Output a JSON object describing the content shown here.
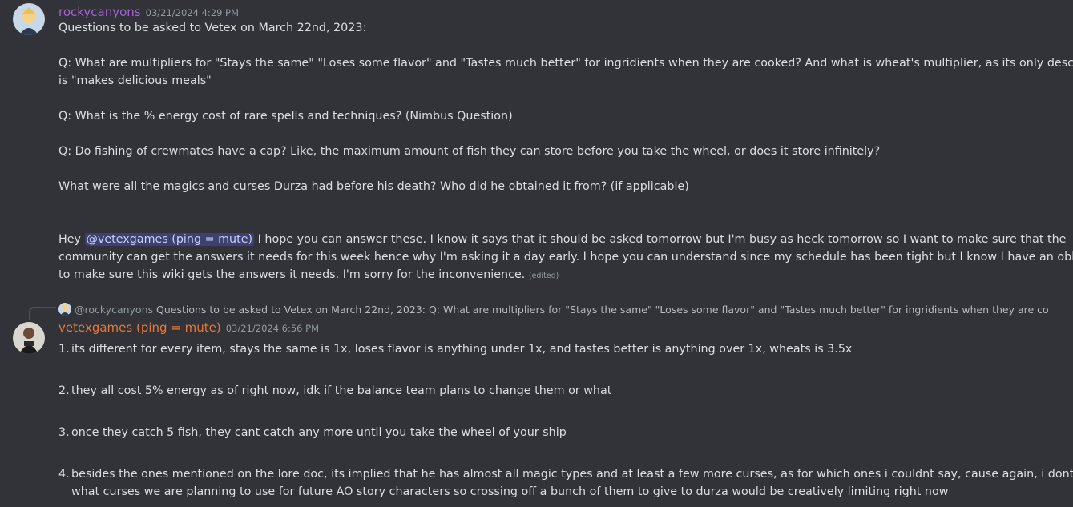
{
  "message1": {
    "username": "rockycanyons",
    "username_color": "#a95fd6",
    "timestamp": "03/21/2024 4:29 PM",
    "title_line": "Questions to be asked to Vetex on March 22nd, 2023:",
    "q1_line1": "Q: What are multipliers for \"Stays the same\" \"Loses some flavor\" and \"Tastes much better\" for ingridients when they are cooked? And what is wheat's multiplier, as its only description",
    "q1_line2": "is \"makes delicious meals\"",
    "q2": "Q: What is the % energy cost of rare spells and techniques? (Nimbus Question)",
    "q3": "Q: Do fishing of crewmates have a cap? Like, the maximum amount of fish they can store before you take the wheel, or does it store infinitely?",
    "q4": "What were all the magics and curses Durza had before his death? Who did he obtained it from? (if applicable)",
    "closing_prefix": "Hey ",
    "mention": "@vetexgames (ping = mute)",
    "closing_line1_rest": " I hope you can answer these. I know it says that it should be asked tomorrow but I'm busy as heck tomorrow so I want to make sure that the",
    "closing_line2": "community can get the answers it needs for this week hence why I'm asking it a day early. I hope you can understand since my schedule has been tight but I know I have an obligation",
    "closing_line3": "to make sure this wiki gets the answers it needs. I'm sorry for the inconvenience.",
    "edited_label": "(edited)"
  },
  "reply_reference": {
    "username": "@rockycanyons",
    "preview": "Questions to be asked to Vetex on March 22nd, 2023: Q: What are multipliers for \"Stays the same\" \"Loses some flavor\" and \"Tastes much better\" for ingridients when they are cooked? And w"
  },
  "message2": {
    "username": "vetexgames (ping = mute)",
    "username_color": "#e8773a",
    "timestamp": "03/21/2024 6:56 PM",
    "answers": [
      {
        "num": "1.",
        "lines": [
          "its different for every item, stays the same is 1x, loses flavor is anything under 1x, and tastes better is anything over 1x, wheats is 3.5x"
        ]
      },
      {
        "num": "2.",
        "lines": [
          "they all cost 5% energy as of right now, idk if the balance team plans to change them or what"
        ]
      },
      {
        "num": "3.",
        "lines": [
          "once they catch 5 fish, they cant catch any more until you take the wheel of your ship"
        ]
      },
      {
        "num": "4.",
        "lines": [
          "besides the ones mentioned on the lore doc, its implied that he has almost all magic types and at least a few more curses, as for which ones i couldnt say, cause again, i dont know",
          "what curses we are planning to use for future AO story characters so crossing off a bunch of them to give to durza would be creatively limiting right now"
        ]
      }
    ]
  }
}
